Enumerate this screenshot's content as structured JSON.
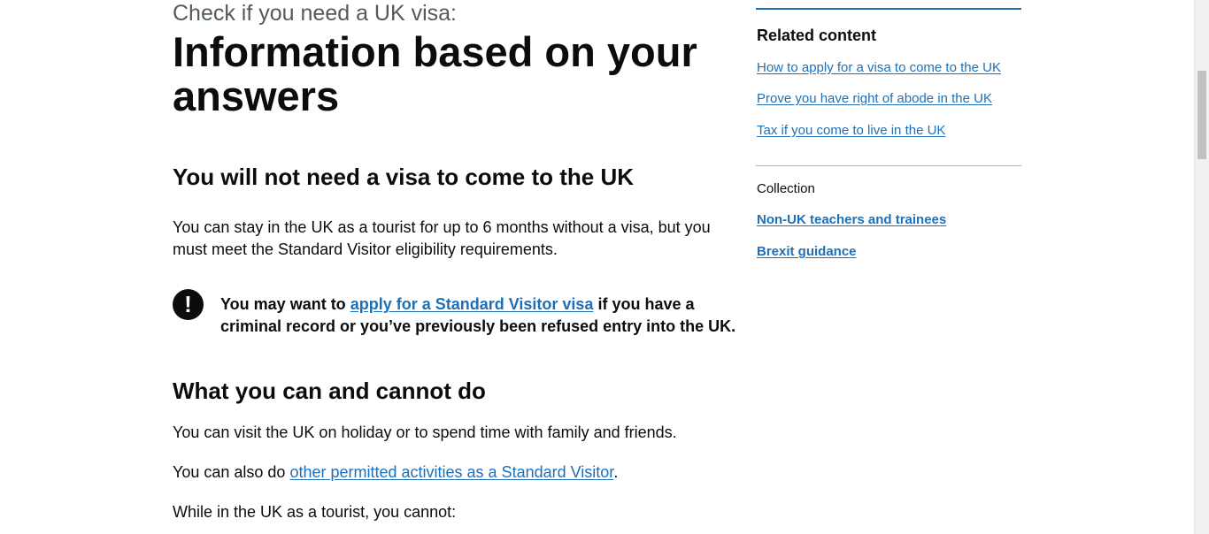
{
  "main": {
    "caption": "Check if you need a UK visa:",
    "title": "Information based on your answers",
    "heading_visa": "You will not need a visa to come to the UK",
    "para_stay": "You can stay in the UK as a tourist for up to 6 months without a visa, but you must meet the Standard Visitor eligibility requirements.",
    "warning": {
      "icon": "!",
      "text_before": "You may want to ",
      "link": "apply for a Standard Visitor visa",
      "text_after": " if you have a criminal record or you’ve previously been refused entry into the UK."
    },
    "heading_can": "What you can and cannot do",
    "para_holiday": "You can visit the UK on holiday or to spend time with family and friends.",
    "para_also_before": "You can also do ",
    "para_also_link": "other permitted activities as a Standard Visitor",
    "para_also_after": ".",
    "para_cannot": "While in the UK as a tourist, you cannot:"
  },
  "aside": {
    "related_heading": "Related content",
    "related_links": [
      "How to apply for a visa to come to the UK",
      "Prove you have right of abode in the UK",
      "Tax if you come to live in the UK"
    ],
    "collection_label": "Collection",
    "collection_links": [
      "Non-UK teachers and trainees",
      "Brexit guidance"
    ]
  },
  "colors": {
    "link": "#1d70b8",
    "text": "#0b0c0c",
    "caption": "#505a5f",
    "rule_top": "#1d70b8",
    "rule_mid": "#b1b4b6"
  }
}
